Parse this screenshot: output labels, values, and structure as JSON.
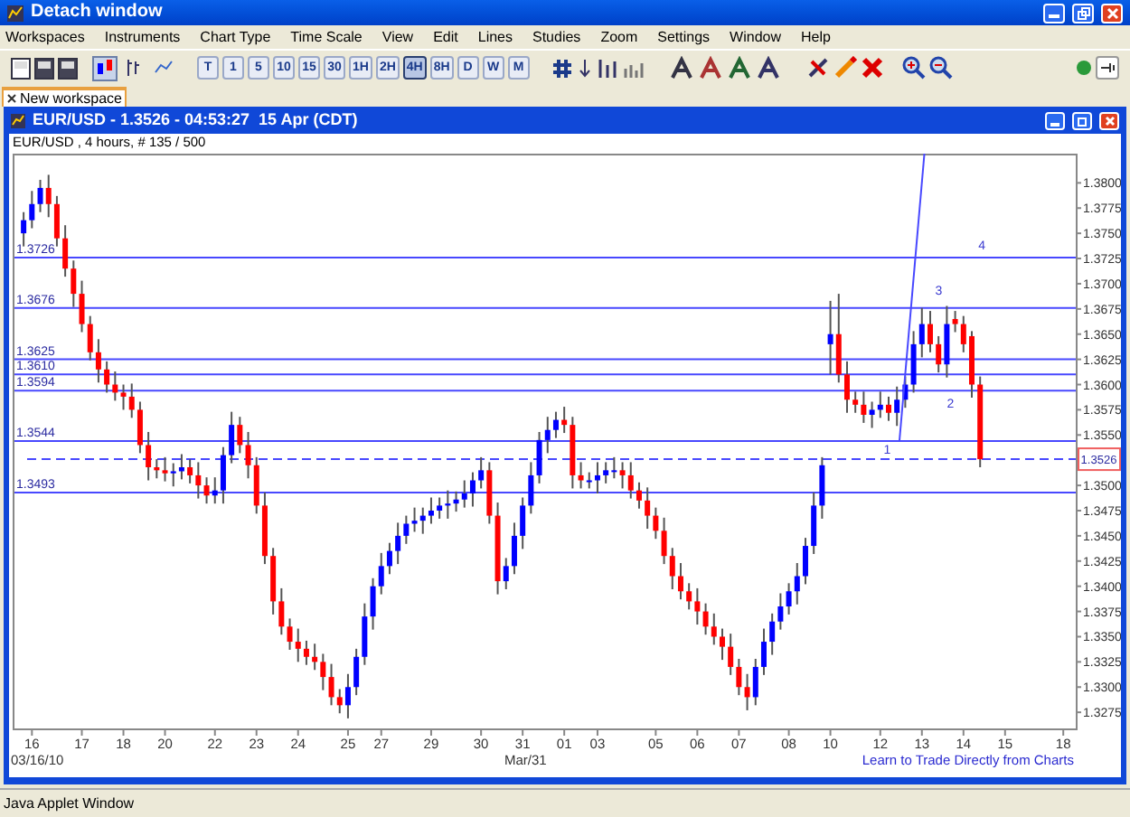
{
  "window": {
    "title": "Detach window"
  },
  "menu": [
    "Workspaces",
    "Instruments",
    "Chart Type",
    "Time Scale",
    "View",
    "Edit",
    "Lines",
    "Studies",
    "Zoom",
    "Settings",
    "Window",
    "Help"
  ],
  "chart_types": [
    {
      "kind": "candles",
      "selected": true
    },
    {
      "kind": "bars",
      "selected": false
    },
    {
      "kind": "line",
      "selected": false
    }
  ],
  "time_scales": [
    {
      "label": "T",
      "selected": false
    },
    {
      "label": "1",
      "selected": false
    },
    {
      "label": "5",
      "selected": false
    },
    {
      "label": "10",
      "selected": false
    },
    {
      "label": "15",
      "selected": false
    },
    {
      "label": "30",
      "selected": false
    },
    {
      "label": "1H",
      "selected": false
    },
    {
      "label": "2H",
      "selected": false
    },
    {
      "label": "4H",
      "selected": true
    },
    {
      "label": "8H",
      "selected": false
    },
    {
      "label": "D",
      "selected": false
    },
    {
      "label": "W",
      "selected": false
    },
    {
      "label": "M",
      "selected": false
    }
  ],
  "tabs": [
    {
      "label": "New workspace",
      "selected": true
    }
  ],
  "chart_window": {
    "title": "EUR/USD - 1.3526 - 04:53:27  15 Apr (CDT)",
    "header": "EUR/USD , 4 hours, # 135 / 500",
    "chart_data": {
      "type": "candlestick",
      "categories": [
        null,
        "16",
        null,
        null,
        null,
        null,
        null,
        "17",
        null,
        null,
        null,
        null,
        "18",
        null,
        null,
        null,
        null,
        "20",
        null,
        null,
        null,
        null,
        null,
        "22",
        null,
        null,
        null,
        null,
        "23",
        null,
        null,
        null,
        null,
        "24",
        null,
        null,
        null,
        null,
        null,
        "25",
        null,
        null,
        null,
        "27",
        null,
        null,
        null,
        null,
        null,
        "29",
        null,
        null,
        null,
        null,
        null,
        "30",
        null,
        null,
        null,
        null,
        "31",
        null,
        null,
        null,
        null,
        "01",
        null,
        null,
        null,
        "03",
        null,
        null,
        null,
        null,
        null,
        null,
        "05",
        null,
        null,
        null,
        null,
        "06",
        null,
        null,
        null,
        null,
        "07",
        null,
        null,
        null,
        null,
        null,
        "08",
        null,
        null,
        null,
        null,
        "10",
        null,
        null,
        null,
        null,
        null,
        "12",
        null,
        null,
        null,
        null,
        "13",
        null,
        null,
        null,
        null,
        "14",
        null,
        null,
        null,
        null,
        "15",
        null,
        null,
        null,
        null,
        null,
        null,
        "18"
      ],
      "ohlc": [
        [
          1.375,
          1.3771,
          1.3737,
          1.3763
        ],
        [
          1.3763,
          1.3792,
          1.3755,
          1.3779
        ],
        [
          1.3779,
          1.3803,
          1.3771,
          1.3795
        ],
        [
          1.3795,
          1.3808,
          1.3766,
          1.3779
        ],
        [
          1.3779,
          1.3787,
          1.3737,
          1.3745
        ],
        [
          1.3745,
          1.3758,
          1.3707,
          1.3715
        ],
        [
          1.3715,
          1.3723,
          1.3677,
          1.369
        ],
        [
          1.369,
          1.3703,
          1.3652,
          1.366
        ],
        [
          1.366,
          1.3668,
          1.3624,
          1.3632
        ],
        [
          1.3632,
          1.3645,
          1.3602,
          1.3615
        ],
        [
          1.3615,
          1.3623,
          1.3592,
          1.36
        ],
        [
          1.36,
          1.3613,
          1.3584,
          1.3592
        ],
        [
          1.3592,
          1.36,
          1.3575,
          1.3588
        ],
        [
          1.3588,
          1.3601,
          1.3567,
          1.3575
        ],
        [
          1.3575,
          1.3583,
          1.3532,
          1.354
        ],
        [
          1.354,
          1.3553,
          1.3505,
          1.3518
        ],
        [
          1.3518,
          1.3526,
          1.3507,
          1.3515
        ],
        [
          1.3515,
          1.3528,
          1.3504,
          1.3512
        ],
        [
          1.3512,
          1.3522,
          1.3499,
          1.3514
        ],
        [
          1.3514,
          1.3531,
          1.3506,
          1.3518
        ],
        [
          1.3518,
          1.3526,
          1.3502,
          1.351
        ],
        [
          1.351,
          1.3523,
          1.3487,
          1.35
        ],
        [
          1.35,
          1.3508,
          1.3482,
          1.349
        ],
        [
          1.349,
          1.3508,
          1.3482,
          1.3495
        ],
        [
          1.3495,
          1.3538,
          1.3482,
          1.353
        ],
        [
          1.353,
          1.3573,
          1.3522,
          1.356
        ],
        [
          1.356,
          1.3568,
          1.3532,
          1.354
        ],
        [
          1.354,
          1.3553,
          1.3507,
          1.352
        ],
        [
          1.352,
          1.3528,
          1.3472,
          1.348
        ],
        [
          1.348,
          1.3493,
          1.3422,
          1.343
        ],
        [
          1.343,
          1.3438,
          1.3372,
          1.3385
        ],
        [
          1.3385,
          1.3398,
          1.3352,
          1.336
        ],
        [
          1.336,
          1.3368,
          1.3337,
          1.3345
        ],
        [
          1.3345,
          1.3358,
          1.3325,
          1.3338
        ],
        [
          1.3338,
          1.3346,
          1.3322,
          1.333
        ],
        [
          1.333,
          1.3343,
          1.3317,
          1.3325
        ],
        [
          1.3325,
          1.3333,
          1.3297,
          1.331
        ],
        [
          1.331,
          1.3323,
          1.3282,
          1.329
        ],
        [
          1.329,
          1.3298,
          1.3274,
          1.3282
        ],
        [
          1.3282,
          1.3313,
          1.3269,
          1.33
        ],
        [
          1.33,
          1.3338,
          1.3292,
          1.333
        ],
        [
          1.333,
          1.3383,
          1.3322,
          1.337
        ],
        [
          1.337,
          1.3408,
          1.3357,
          1.34
        ],
        [
          1.34,
          1.3433,
          1.3392,
          1.342
        ],
        [
          1.342,
          1.3443,
          1.3412,
          1.3435
        ],
        [
          1.3435,
          1.3463,
          1.3422,
          1.345
        ],
        [
          1.345,
          1.347,
          1.3442,
          1.3462
        ],
        [
          1.3462,
          1.3478,
          1.3454,
          1.3465
        ],
        [
          1.3465,
          1.3478,
          1.3452,
          1.347
        ],
        [
          1.347,
          1.3488,
          1.3462,
          1.3475
        ],
        [
          1.3475,
          1.3488,
          1.3467,
          1.348
        ],
        [
          1.348,
          1.3495,
          1.3467,
          1.3482
        ],
        [
          1.3482,
          1.3494,
          1.3474,
          1.3486
        ],
        [
          1.3486,
          1.3505,
          1.3478,
          1.3492
        ],
        [
          1.3492,
          1.3513,
          1.3479,
          1.3505
        ],
        [
          1.3505,
          1.3528,
          1.3497,
          1.3515
        ],
        [
          1.3515,
          1.3523,
          1.3462,
          1.347
        ],
        [
          1.347,
          1.3483,
          1.3392,
          1.3405
        ],
        [
          1.3405,
          1.3428,
          1.3397,
          1.342
        ],
        [
          1.342,
          1.3463,
          1.3412,
          1.345
        ],
        [
          1.345,
          1.3488,
          1.3437,
          1.348
        ],
        [
          1.348,
          1.3523,
          1.3472,
          1.351
        ],
        [
          1.351,
          1.3553,
          1.3502,
          1.3545
        ],
        [
          1.3545,
          1.3568,
          1.3532,
          1.3555
        ],
        [
          1.3555,
          1.3573,
          1.3547,
          1.3565
        ],
        [
          1.3565,
          1.3578,
          1.3552,
          1.356
        ],
        [
          1.356,
          1.3568,
          1.3497,
          1.351
        ],
        [
          1.351,
          1.3523,
          1.3497,
          1.3505
        ],
        [
          1.3505,
          1.3513,
          1.3497,
          1.3505
        ],
        [
          1.3505,
          1.3523,
          1.3492,
          1.351
        ],
        [
          1.351,
          1.3523,
          1.3502,
          1.3515
        ],
        [
          1.3515,
          1.3528,
          1.3507,
          1.3515
        ],
        [
          1.3515,
          1.3523,
          1.3497,
          1.351
        ],
        [
          1.351,
          1.3523,
          1.3487,
          1.3495
        ],
        [
          1.3495,
          1.3503,
          1.3477,
          1.3485
        ],
        [
          1.3485,
          1.3498,
          1.3457,
          1.347
        ],
        [
          1.347,
          1.3478,
          1.3447,
          1.3455
        ],
        [
          1.3455,
          1.3468,
          1.3422,
          1.343
        ],
        [
          1.343,
          1.3438,
          1.3397,
          1.341
        ],
        [
          1.341,
          1.3423,
          1.3387,
          1.3395
        ],
        [
          1.3395,
          1.3403,
          1.3377,
          1.3385
        ],
        [
          1.3385,
          1.3398,
          1.3362,
          1.3375
        ],
        [
          1.3375,
          1.3383,
          1.3352,
          1.336
        ],
        [
          1.336,
          1.3373,
          1.3342,
          1.335
        ],
        [
          1.335,
          1.3358,
          1.3327,
          1.334
        ],
        [
          1.334,
          1.3353,
          1.3312,
          1.332
        ],
        [
          1.332,
          1.3328,
          1.3292,
          1.33
        ],
        [
          1.33,
          1.3313,
          1.3277,
          1.329
        ],
        [
          1.329,
          1.3328,
          1.3282,
          1.332
        ],
        [
          1.332,
          1.3358,
          1.3312,
          1.3345
        ],
        [
          1.3345,
          1.3373,
          1.3332,
          1.3365
        ],
        [
          1.3365,
          1.3393,
          1.3357,
          1.338
        ],
        [
          1.338,
          1.3403,
          1.3372,
          1.3395
        ],
        [
          1.3395,
          1.3423,
          1.3382,
          1.341
        ],
        [
          1.341,
          1.3448,
          1.3402,
          1.344
        ],
        [
          1.344,
          1.3493,
          1.3432,
          1.348
        ],
        [
          1.348,
          1.3528,
          1.3467,
          1.352
        ],
        [
          1.364,
          1.3683,
          1.361,
          1.365
        ],
        [
          1.365,
          1.369,
          1.3602,
          1.361
        ],
        [
          1.361,
          1.3623,
          1.3572,
          1.3585
        ],
        [
          1.3585,
          1.3593,
          1.3572,
          1.358
        ],
        [
          1.358,
          1.3593,
          1.3562,
          1.357
        ],
        [
          1.357,
          1.3583,
          1.3557,
          1.3575
        ],
        [
          1.3575,
          1.3593,
          1.3567,
          1.358
        ],
        [
          1.358,
          1.3588,
          1.3564,
          1.3572
        ],
        [
          1.3572,
          1.3598,
          1.3559,
          1.3585
        ],
        [
          1.3585,
          1.3608,
          1.3577,
          1.36
        ],
        [
          1.36,
          1.3653,
          1.3592,
          1.364
        ],
        [
          1.364,
          1.3676,
          1.3627,
          1.366
        ],
        [
          1.366,
          1.3673,
          1.3632,
          1.364
        ],
        [
          1.364,
          1.3648,
          1.3612,
          1.362
        ],
        [
          1.362,
          1.3678,
          1.3607,
          1.366
        ],
        [
          1.3665,
          1.3673,
          1.3652,
          1.366
        ],
        [
          1.366,
          1.3668,
          1.3632,
          1.364
        ],
        [
          1.3648,
          1.3653,
          1.3587,
          1.36
        ],
        [
          1.36,
          1.3608,
          1.3518,
          1.3526
        ],
        null,
        null,
        null,
        null,
        null,
        null,
        null,
        null,
        null,
        null
      ],
      "ylim": [
        1.3259,
        1.3829
      ],
      "yticks": [
        {
          "value": 1.38,
          "label": "1.3800"
        },
        {
          "value": 1.3775,
          "label": "1.3775"
        },
        {
          "value": 1.375,
          "label": "1.3750"
        },
        {
          "value": 1.3725,
          "label": "1.3725"
        },
        {
          "value": 1.37,
          "label": "1.3700"
        },
        {
          "value": 1.3675,
          "label": "1.3675"
        },
        {
          "value": 1.365,
          "label": "1.3650"
        },
        {
          "value": 1.3625,
          "label": "1.3625"
        },
        {
          "value": 1.36,
          "label": "1.3600"
        },
        {
          "value": 1.3575,
          "label": "1.3575"
        },
        {
          "value": 1.355,
          "label": "1.3550"
        },
        {
          "value": 1.35,
          "label": "1.3500"
        },
        {
          "value": 1.3475,
          "label": "1.3475"
        },
        {
          "value": 1.345,
          "label": "1.3450"
        },
        {
          "value": 1.3425,
          "label": "1.3425"
        },
        {
          "value": 1.34,
          "label": "1.3400"
        },
        {
          "value": 1.3375,
          "label": "1.3375"
        },
        {
          "value": 1.335,
          "label": "1.3350"
        },
        {
          "value": 1.3325,
          "label": "1.3325"
        },
        {
          "value": 1.33,
          "label": "1.3300"
        },
        {
          "value": 1.3275,
          "label": "1.3275"
        }
      ],
      "ref_lines": [
        {
          "axis": "y",
          "value": 1.3726,
          "label": "1.3726"
        },
        {
          "axis": "y",
          "value": 1.3676,
          "label": "1.3676"
        },
        {
          "axis": "y",
          "value": 1.3625,
          "label": "1.3625"
        },
        {
          "axis": "y",
          "value": 1.361,
          "label": "1.3610"
        },
        {
          "axis": "y",
          "value": 1.3594,
          "label": "1.3594"
        },
        {
          "axis": "y",
          "value": 1.3544,
          "label": "1.3544"
        },
        {
          "axis": "y",
          "value": 1.3493,
          "label": "1.3493"
        },
        {
          "axis": "y",
          "value": 1.3526,
          "label": "1.3526"
        }
      ],
      "annotations": [
        "1",
        "2",
        "3",
        "4"
      ]
    },
    "x_subticks": [
      "03/16/10",
      "Mar/31"
    ],
    "link": "Learn to Trade Directly from Charts"
  },
  "status_bar": "Java Applet Window"
}
